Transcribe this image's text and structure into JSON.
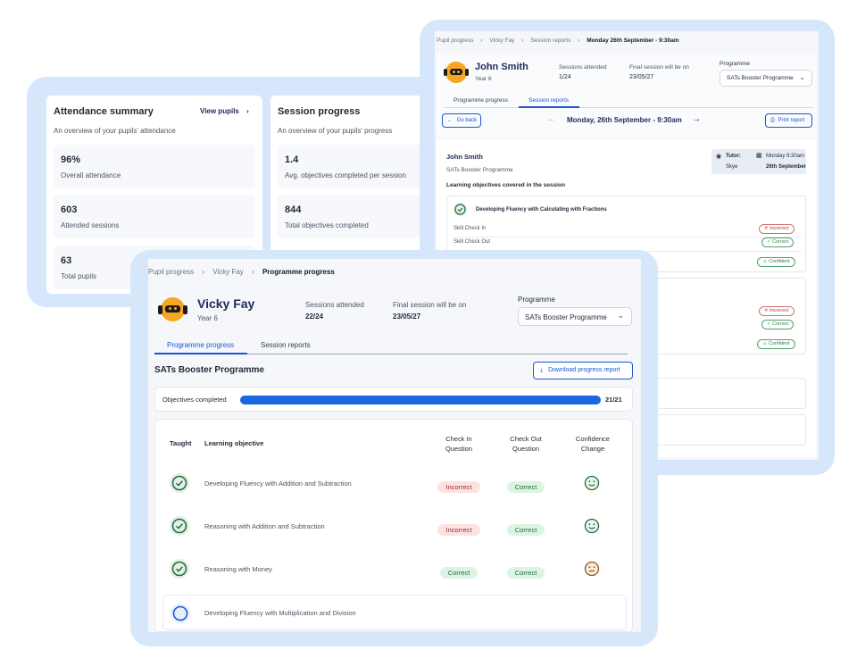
{
  "attendance": {
    "title": "Attendance summary",
    "view_link": "View pupils",
    "subtitle": "An overview of your pupils' attendance",
    "stats": [
      {
        "value": "96%",
        "label": "Overall attendance"
      },
      {
        "value": "603",
        "label": "Attended sessions"
      },
      {
        "value": "63",
        "label": "Total pupils"
      }
    ]
  },
  "session_progress": {
    "title": "Session progress",
    "subtitle": "An overview of your pupils' progress",
    "stats": [
      {
        "value": "1.4",
        "label": "Avg. objectives completed per session"
      },
      {
        "value": "844",
        "label": "Total objectives completed"
      }
    ]
  },
  "back": {
    "breadcrumb": [
      "Pupil progress",
      "Vicky Fay",
      "Session reports",
      "Monday 26th September - 9:30am"
    ],
    "pupil": {
      "name": "John Smith",
      "year": "Year 6"
    },
    "sessions_attended_label": "Sessions attended",
    "sessions_attended_value": "1/24",
    "final_session_label": "Final session will be on",
    "final_session_value": "23/05/27",
    "programme_label": "Programme",
    "programme_value": "SATs Booster Programme",
    "tabs": [
      "Programme progress",
      "Session reports"
    ],
    "go_back": "Go back",
    "session_title": "Monday, 26th September - 9:30am",
    "print": "Print report",
    "report": {
      "name": "John Smith",
      "programme": "SATs Booster Programme",
      "tutor_label": "Tutor:",
      "tutor_name": "Skye",
      "date_line1": "Monday 9:30am",
      "date_line2": "26th September",
      "objectives_heading": "Learning objectives covered in the session",
      "objective_title": "Developing Fluency with Calculating with Fractions",
      "check_in": "Skill Check In",
      "check_out": "Skill Check Out",
      "incorrect": "Incorrect",
      "correct": "Correct",
      "confident": "Confident"
    }
  },
  "front": {
    "breadcrumb": [
      "Pupil progress",
      "Vicky Fay",
      "Programme progress"
    ],
    "pupil": {
      "name": "Vicky Fay",
      "year": "Year 6"
    },
    "sessions_attended_label": "Sessions attended",
    "sessions_attended_value": "22/24",
    "final_session_label": "Final session will be on",
    "final_session_value": "23/05/27",
    "programme_label": "Programme",
    "programme_value": "SATs Booster Programme",
    "tabs": [
      "Programme progress",
      "Session reports"
    ],
    "section_title": "SATs Booster Programme",
    "download": "Download progress report",
    "objectives_label": "Objectives completed",
    "objectives_value": "21/21",
    "objectives_fraction": 1.0,
    "table_headers": {
      "taught": "Taught",
      "objective": "Learning objective",
      "check_in_1": "Check In",
      "check_in_2": "Question",
      "check_out_1": "Check Out",
      "check_out_2": "Question",
      "confidence_1": "Confidence",
      "confidence_2": "Change"
    },
    "rows": [
      {
        "objective": "Developing Fluency with Addition and Subtraction",
        "check_in": "Incorrect",
        "check_out": "Correct"
      },
      {
        "objective": "Reasoning with Addition and Subtraction",
        "check_in": "Incorrect",
        "check_out": "Correct"
      },
      {
        "objective": "Reasoning with Money",
        "check_in": "Correct",
        "check_out": "Correct"
      },
      {
        "objective": "Developing Fluency with Multiplication and Division"
      }
    ]
  }
}
